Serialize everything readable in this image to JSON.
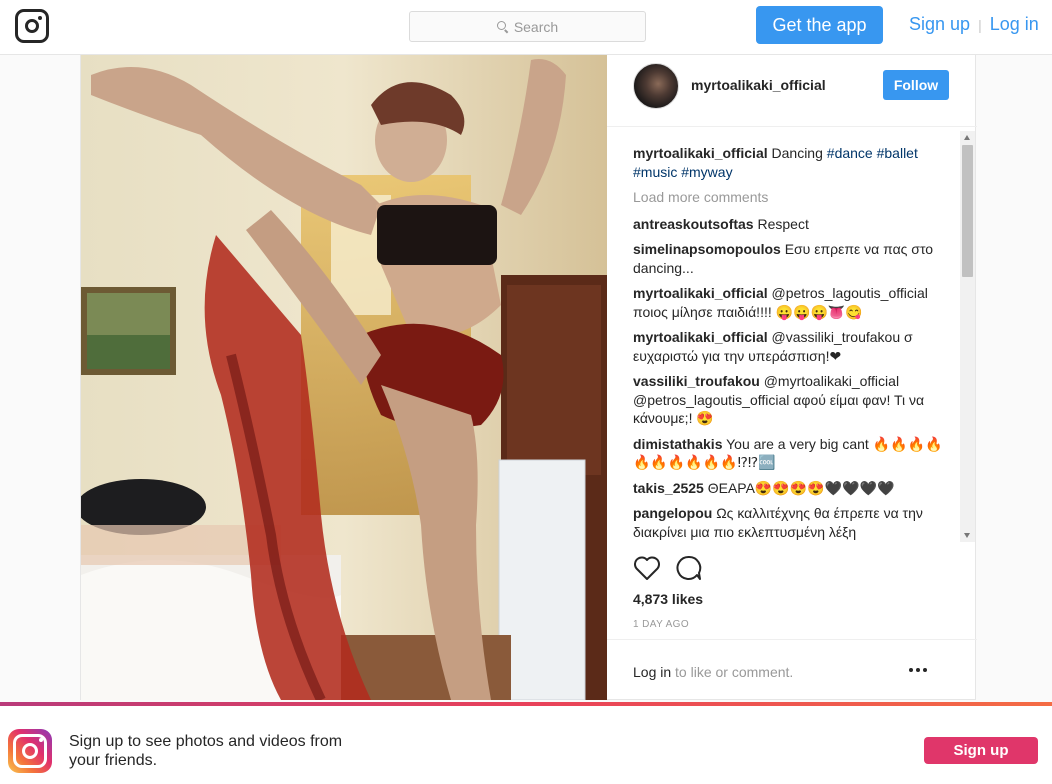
{
  "nav": {
    "search_placeholder": "Search",
    "get_app": "Get the app",
    "sign_up": "Sign up",
    "separator": "|",
    "log_in": "Log in"
  },
  "post": {
    "owner": "myrtoalikaki_official",
    "follow": "Follow",
    "caption": {
      "user": "myrtoalikaki_official",
      "text": "Dancing",
      "tags": "#dance #ballet #music #myway"
    },
    "load_more": "Load more comments",
    "comments": [
      {
        "user": "antreaskoutsoftas",
        "text": "Respect"
      },
      {
        "user": "simelinapsomopoulos",
        "text": "Εσυ επρεπε να πας στο dancing..."
      },
      {
        "user": "myrtoalikaki_official",
        "text": "@petros_lagoutis_official ποιος μίλησε παιδιά!!!! 😛😛😛👅😋"
      },
      {
        "user": "myrtoalikaki_official",
        "text": "@vassiliki_troufakou σ ευχαριστώ για την υπεράσπιση!❤"
      },
      {
        "user": "vassiliki_troufakou",
        "text": "@myrtoalikaki_official @petros_lagoutis_official αφού είμαι φαν! Τι να κάνουμε;! 😍"
      },
      {
        "user": "dimistathakis",
        "text": "You are a very big cant 🔥🔥🔥🔥🔥🔥🔥🔥🔥🔥⁉⁉🆒"
      },
      {
        "user": "takis_2525",
        "text": "ΘΕΑΡΑ😍😍😍😍🖤🖤🖤🖤"
      },
      {
        "user": "pangelopou",
        "text": "Ως καλλιτέχνης θα έπρεπε να την διακρίνει μια πιο εκλεπτυσμένη λέξη"
      }
    ],
    "likes": "4,873 likes",
    "time": "1 DAY AGO",
    "login_link": "Log in",
    "login_rest": " to like or comment."
  },
  "banner": {
    "text": "Sign up to see photos and videos from your friends.",
    "sign_up": "Sign up"
  },
  "colors": {
    "accent": "#3897f0",
    "banner_button": "#e0366a"
  }
}
